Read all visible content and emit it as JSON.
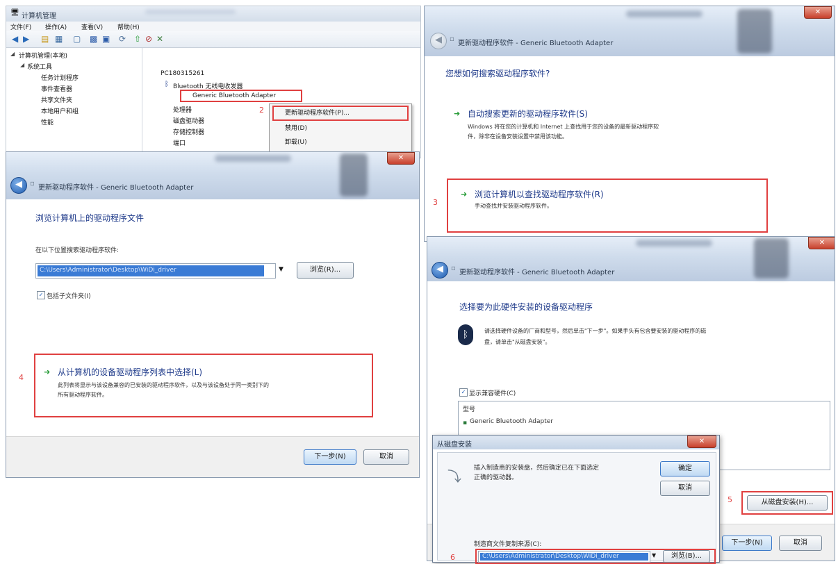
{
  "device_manager": {
    "title": "计算机管理",
    "menu": [
      "文件(F)",
      "操作(A)",
      "查看(V)",
      "帮助(H)"
    ],
    "left_tree": [
      "计算机管理(本地)",
      "系统工具",
      "任务计划程序",
      "事件查看器",
      "共享文件夹",
      "本地用户和组",
      "性能"
    ],
    "right_tree": {
      "root": "PC180315261",
      "bluetooth_group": "Bluetooth 无线电收发器",
      "device": "Generic Bluetooth Adapter",
      "other": [
        "处理器",
        "磁盘驱动器",
        "存储控制器",
        "端口"
      ]
    },
    "step_2": "2",
    "context_menu": {
      "update": "更新驱动程序软件(P)...",
      "disable": "禁用(D)",
      "uninstall": "卸载(U)"
    }
  },
  "dialog_search": {
    "title": "更新驱动程序软件 - Generic Bluetooth Adapter",
    "question": "您想如何搜索驱动程序软件?",
    "option_auto_title": "自动搜索更新的驱动程序软件(S)",
    "option_auto_desc_1": "Windows 将在您的计算机和 Internet 上查找用于您的设备的最新驱动程序软",
    "option_auto_desc_2": "件，除非在设备安装设置中禁用该功能。",
    "step_3": "3",
    "option_browse_title": "浏览计算机以查找驱动程序软件(R)",
    "option_browse_desc": "手动查找并安装驱动程序软件。"
  },
  "dialog_browse": {
    "title": "更新驱动程序软件 - Generic Bluetooth Adapter",
    "heading": "浏览计算机上的驱动程序文件",
    "search_label": "在以下位置搜索驱动程序软件:",
    "path_value": "C:\\Users\\Administrator\\Desktop\\WiDi_driver",
    "browse_btn": "浏览(R)...",
    "include_subfolders": "包括子文件夹(I)",
    "step_4": "4",
    "pick_title": "从计算机的设备驱动程序列表中选择(L)",
    "pick_desc_1": "此列表将显示与该设备兼容的已安装的驱动程序软件，以及与该设备处于同一类别下的",
    "pick_desc_2": "所有驱动程序软件。",
    "next_btn": "下一步(N)",
    "cancel_btn": "取消"
  },
  "dialog_select": {
    "title": "更新驱动程序软件 - Generic Bluetooth Adapter",
    "heading": "选择要为此硬件安装的设备驱动程序",
    "desc_1": "请选择硬件设备的厂商和型号，然后单击\"下一步\"。如果手头有包含要安装的驱动程序的磁",
    "desc_2": "盘，请单击\"从磁盘安装\"。",
    "show_compatible": "显示兼容硬件(C)",
    "list_header": "型号",
    "list_item": "Generic Bluetooth Adapter",
    "step_5": "5",
    "have_disk_btn": "从磁盘安装(H)...",
    "next_btn": "下一步(N)",
    "cancel_btn": "取消"
  },
  "dialog_install_disk": {
    "title": "从磁盘安装",
    "message_1": "插入制造商的安装盘，然后确定已在下面选定",
    "message_2": "正确的驱动器。",
    "ok_btn": "确定",
    "cancel_btn": "取消",
    "browse_btn": "浏览(B)...",
    "copy_label": "制造商文件复制来源(C):",
    "path_value": "C:\\Users\\Administrator\\Desktop\\WiDi_driver",
    "step_6": "6",
    "browse2_btn": "浏览(B)..."
  }
}
